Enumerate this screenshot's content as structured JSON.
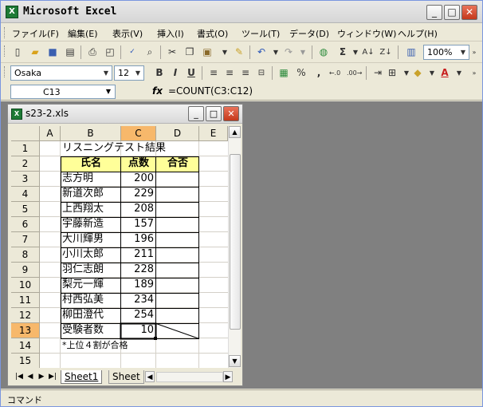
{
  "window": {
    "title": "Microsoft Excel",
    "minimize": "_",
    "maximize": "□",
    "close": "✕"
  },
  "menu": {
    "items": [
      "ファイル(F)",
      "編集(E)",
      "表示(V)",
      "挿入(I)",
      "書式(O)",
      "ツール(T)",
      "データ(D)",
      "ウィンドウ(W)",
      "ヘルプ(H)"
    ]
  },
  "toolbar": {
    "zoom": "100%"
  },
  "format": {
    "font": "Osaka",
    "size": "12",
    "bold": "B",
    "italic": "I",
    "underline": "U",
    "percent": "%",
    "comma": ","
  },
  "formula_bar": {
    "name_box": "C13",
    "fx": "fx",
    "formula": "=COUNT(C3:C12)"
  },
  "workbook": {
    "file_name": "s23-2.xls",
    "columns": [
      "A",
      "B",
      "C",
      "D",
      "E"
    ],
    "rows": [
      "1",
      "2",
      "3",
      "4",
      "5",
      "6",
      "7",
      "8",
      "9",
      "10",
      "11",
      "12",
      "13",
      "14",
      "15"
    ],
    "title": "リスニングテスト結果",
    "headers": {
      "name": "氏名",
      "score": "点数",
      "pass": "合否"
    },
    "records": [
      {
        "name": "志方明",
        "score": "200"
      },
      {
        "name": "新道次郎",
        "score": "229"
      },
      {
        "name": "上西翔太",
        "score": "208"
      },
      {
        "name": "宇藤新造",
        "score": "157"
      },
      {
        "name": "大川輝男",
        "score": "196"
      },
      {
        "name": "小川太郎",
        "score": "211"
      },
      {
        "name": "羽仁志朗",
        "score": "228"
      },
      {
        "name": "梨元一輝",
        "score": "189"
      },
      {
        "name": "村西弘美",
        "score": "234"
      },
      {
        "name": "柳田澄代",
        "score": "254"
      }
    ],
    "count_label": "受験者数",
    "count_value": "10",
    "note": "*上位４割が合格",
    "sheet_tabs": [
      "Sheet1",
      "Sheet"
    ]
  },
  "status": {
    "text": "コマンド"
  }
}
